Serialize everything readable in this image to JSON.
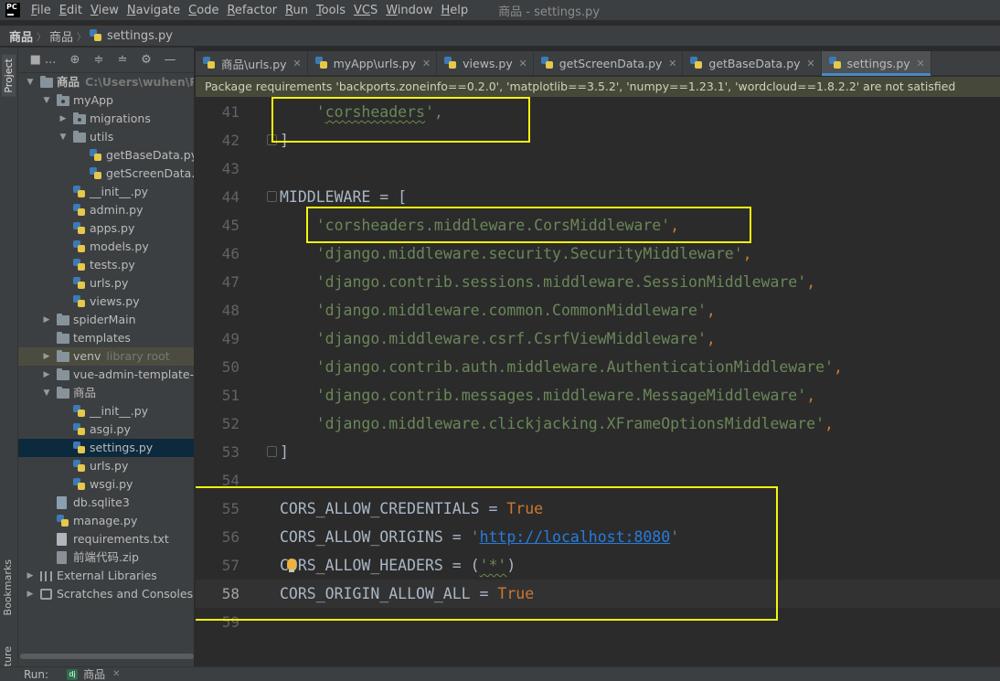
{
  "menubar": {
    "logo_text": "PC",
    "items": [
      {
        "mn": "F",
        "rest": "ile"
      },
      {
        "mn": "E",
        "rest": "dit"
      },
      {
        "mn": "V",
        "rest": "iew"
      },
      {
        "mn": "N",
        "rest": "avigate"
      },
      {
        "mn": "C",
        "rest": "ode"
      },
      {
        "mn": "R",
        "rest": "efactor"
      },
      {
        "mn": "R",
        "rest": "un"
      },
      {
        "mn": "T",
        "rest": "ools"
      },
      {
        "mn": "VC",
        "rest": "S"
      },
      {
        "mn": "W",
        "rest": "indow"
      },
      {
        "mn": "H",
        "rest": "elp"
      }
    ],
    "window_title": "商品 - settings.py"
  },
  "breadcrumb": {
    "project": "商品",
    "folder": "商品",
    "file": "settings.py"
  },
  "toolstrip": {
    "project": "Project",
    "bookmarks": "Bookmarks",
    "structure": "ucture"
  },
  "project_panel": {
    "title": "■ ...",
    "toolbar_icons": [
      "target-icon",
      "expand-all-icon",
      "collapse-all-icon",
      "gear-icon",
      "hide-icon"
    ],
    "tree": [
      {
        "label": "商品",
        "hint": "C:\\Users\\wuhen\\Pych",
        "indent": 0,
        "arrow": "down",
        "icon": "folder",
        "bold": true
      },
      {
        "label": "myApp",
        "indent": 1,
        "arrow": "down",
        "icon": "folder-pkg"
      },
      {
        "label": "migrations",
        "indent": 2,
        "arrow": "right",
        "icon": "folder-pkg"
      },
      {
        "label": "utils",
        "indent": 2,
        "arrow": "down",
        "icon": "folder"
      },
      {
        "label": "getBaseData.py",
        "indent": 3,
        "icon": "py"
      },
      {
        "label": "getScreenData.p",
        "indent": 3,
        "icon": "py"
      },
      {
        "label": "__init__.py",
        "indent": 2,
        "icon": "py"
      },
      {
        "label": "admin.py",
        "indent": 2,
        "icon": "py"
      },
      {
        "label": "apps.py",
        "indent": 2,
        "icon": "py"
      },
      {
        "label": "models.py",
        "indent": 2,
        "icon": "py"
      },
      {
        "label": "tests.py",
        "indent": 2,
        "icon": "py"
      },
      {
        "label": "urls.py",
        "indent": 2,
        "icon": "py"
      },
      {
        "label": "views.py",
        "indent": 2,
        "icon": "py"
      },
      {
        "label": "spiderMain",
        "indent": 1,
        "arrow": "right",
        "icon": "folder"
      },
      {
        "label": "templates",
        "indent": 1,
        "icon": "folder"
      },
      {
        "label": "venv",
        "hint": "library root",
        "indent": 1,
        "arrow": "right",
        "icon": "folder",
        "lib": true
      },
      {
        "label": "vue-admin-template-m",
        "indent": 1,
        "arrow": "right",
        "icon": "folder"
      },
      {
        "label": "商品",
        "indent": 1,
        "arrow": "down",
        "icon": "folder"
      },
      {
        "label": "__init__.py",
        "indent": 2,
        "icon": "py"
      },
      {
        "label": "asgi.py",
        "indent": 2,
        "icon": "py"
      },
      {
        "label": "settings.py",
        "indent": 2,
        "icon": "py",
        "selected": true
      },
      {
        "label": "urls.py",
        "indent": 2,
        "icon": "py"
      },
      {
        "label": "wsgi.py",
        "indent": 2,
        "icon": "py"
      },
      {
        "label": "db.sqlite3",
        "indent": 1,
        "icon": "db"
      },
      {
        "label": "manage.py",
        "indent": 1,
        "icon": "py"
      },
      {
        "label": "requirements.txt",
        "indent": 1,
        "icon": "txt"
      },
      {
        "label": "前端代码.zip",
        "indent": 1,
        "icon": "zip"
      },
      {
        "label": "External Libraries",
        "indent": 0,
        "arrow": "right",
        "icon": "lib"
      },
      {
        "label": "Scratches and Consoles",
        "indent": 0,
        "arrow": "right",
        "icon": "scratch"
      }
    ]
  },
  "tabs": [
    {
      "label": "商品\\urls.py",
      "active": false
    },
    {
      "label": "myApp\\urls.py",
      "active": false
    },
    {
      "label": "views.py",
      "active": false
    },
    {
      "label": "getScreenData.py",
      "active": false
    },
    {
      "label": "getBaseData.py",
      "active": false
    },
    {
      "label": "settings.py",
      "active": true
    }
  ],
  "banner": "Package requirements 'backports.zoneinfo==0.2.0', 'matplotlib==3.5.2', 'numpy==1.23.1', 'wordcloud==1.8.2.2' are not satisfied",
  "editor": {
    "lines": [
      {
        "num": "41",
        "fold": false,
        "tokens": [
          {
            "t": "    ",
            "c": ""
          },
          {
            "t": "'",
            "c": "str"
          },
          {
            "t": "corsheaders",
            "c": "str squig"
          },
          {
            "t": "',",
            "c": "str"
          }
        ]
      },
      {
        "num": "42",
        "fold": true,
        "tokens": [
          {
            "t": "]",
            "c": ""
          }
        ]
      },
      {
        "num": "43",
        "fold": false,
        "tokens": []
      },
      {
        "num": "44",
        "fold": true,
        "tokens": [
          {
            "t": "MIDDLEWARE = [",
            "c": ""
          }
        ]
      },
      {
        "num": "45",
        "fold": false,
        "tokens": [
          {
            "t": "    ",
            "c": ""
          },
          {
            "t": "'corsheaders.middleware.CorsMiddleware'",
            "c": "str"
          },
          {
            "t": ",",
            "c": "kw"
          }
        ]
      },
      {
        "num": "46",
        "fold": false,
        "tokens": [
          {
            "t": "    ",
            "c": ""
          },
          {
            "t": "'django.middleware.security.SecurityMiddleware'",
            "c": "str"
          },
          {
            "t": ",",
            "c": "kw"
          }
        ]
      },
      {
        "num": "47",
        "fold": false,
        "tokens": [
          {
            "t": "    ",
            "c": ""
          },
          {
            "t": "'django.contrib.sessions.middleware.SessionMiddleware'",
            "c": "str"
          },
          {
            "t": ",",
            "c": "kw"
          }
        ]
      },
      {
        "num": "48",
        "fold": false,
        "tokens": [
          {
            "t": "    ",
            "c": ""
          },
          {
            "t": "'django.middleware.common.CommonMiddleware'",
            "c": "str"
          },
          {
            "t": ",",
            "c": "kw"
          }
        ]
      },
      {
        "num": "49",
        "fold": false,
        "tokens": [
          {
            "t": "    ",
            "c": ""
          },
          {
            "t": "'django.middleware.csrf.CsrfViewMiddleware'",
            "c": "str"
          },
          {
            "t": ",",
            "c": "kw"
          }
        ]
      },
      {
        "num": "50",
        "fold": false,
        "tokens": [
          {
            "t": "    ",
            "c": ""
          },
          {
            "t": "'django.contrib.auth.middleware.AuthenticationMiddleware'",
            "c": "str"
          },
          {
            "t": ",",
            "c": "kw"
          }
        ]
      },
      {
        "num": "51",
        "fold": false,
        "tokens": [
          {
            "t": "    ",
            "c": ""
          },
          {
            "t": "'django.contrib.messages.middleware.MessageMiddleware'",
            "c": "str"
          },
          {
            "t": ",",
            "c": "kw"
          }
        ]
      },
      {
        "num": "52",
        "fold": false,
        "tokens": [
          {
            "t": "    ",
            "c": ""
          },
          {
            "t": "'django.middleware.clickjacking.XFrameOptionsMiddleware'",
            "c": "str"
          },
          {
            "t": ",",
            "c": "kw"
          }
        ]
      },
      {
        "num": "53",
        "fold": true,
        "tokens": [
          {
            "t": "]",
            "c": ""
          }
        ]
      },
      {
        "num": "54",
        "fold": false,
        "tokens": []
      },
      {
        "num": "55",
        "fold": false,
        "tokens": [
          {
            "t": "CORS_ALLOW_CREDENTIALS = ",
            "c": ""
          },
          {
            "t": "True",
            "c": "kw"
          }
        ]
      },
      {
        "num": "56",
        "fold": false,
        "tokens": [
          {
            "t": "CORS_ALLOW_ORIGINS = ",
            "c": ""
          },
          {
            "t": "'",
            "c": "str"
          },
          {
            "t": "http://localhost:8080",
            "c": "url"
          },
          {
            "t": "'",
            "c": "str"
          }
        ]
      },
      {
        "num": "57",
        "fold": false,
        "bulb": true,
        "tokens": [
          {
            "t": "CORS_ALLOW_HEADERS = (",
            "c": ""
          },
          {
            "t": "'*'",
            "c": "str squig"
          },
          {
            "t": ")",
            "c": ""
          }
        ]
      },
      {
        "num": "58",
        "fold": false,
        "current": true,
        "tokens": [
          {
            "t": "CORS_ORIGIN_ALLOW_ALL = ",
            "c": ""
          },
          {
            "t": "True",
            "c": "kw"
          }
        ]
      },
      {
        "num": "59",
        "fold": false,
        "tokens": []
      }
    ]
  },
  "runbar": {
    "label": "Run:",
    "config": "商品"
  },
  "colors": {
    "accent": "#4a88c7",
    "highlight_box": "#f5f50f",
    "string": "#6a8759",
    "keyword": "#cc7832"
  }
}
